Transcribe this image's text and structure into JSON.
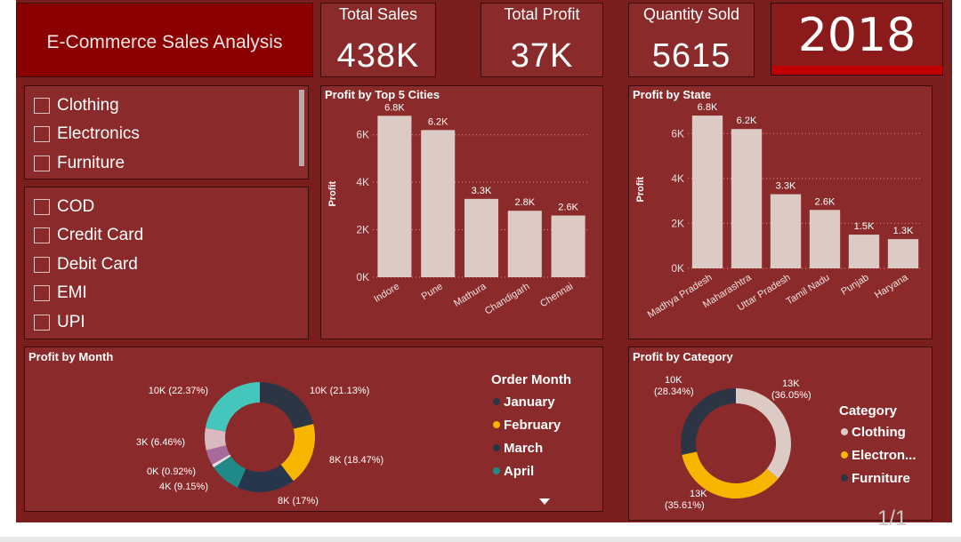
{
  "dashboard": {
    "title": "E-Commerce Sales Analysis",
    "year": "2018",
    "pager": "1/1"
  },
  "cards": {
    "total_sales": {
      "label": "Total Sales",
      "value": "438K"
    },
    "total_profit": {
      "label": "Total Profit",
      "value": "37K"
    },
    "quantity_sold": {
      "label": "Quantity Sold",
      "value": "5615"
    }
  },
  "slicers": {
    "category": [
      "Clothing",
      "Electronics",
      "Furniture"
    ],
    "payment": [
      "COD",
      "Credit Card",
      "Debit Card",
      "EMI",
      "UPI"
    ]
  },
  "colors": {
    "bar": "#dccac5",
    "dark": "#2b3544",
    "yellow": "#f7b500",
    "pink": "#d9b9bf",
    "teal": "#45c6bd",
    "purple": "#a86a9b",
    "teal_dark": "#1f8a87",
    "navy": "#27354d"
  },
  "chart_data": [
    {
      "id": "cities",
      "type": "bar",
      "title": "Profit by Top 5 Cities",
      "ylabel": "Profit",
      "categories": [
        "Indore",
        "Pune",
        "Mathura",
        "Chandigarh",
        "Chennai"
      ],
      "values": [
        6800,
        6200,
        3300,
        2800,
        2600
      ],
      "data_labels": [
        "6.8K",
        "6.2K",
        "3.3K",
        "2.8K",
        "2.6K"
      ],
      "yticks": [
        0,
        2000,
        4000,
        6000
      ],
      "ytick_labels": [
        "0K",
        "2K",
        "4K",
        "6K"
      ],
      "ylim": [
        0,
        7000
      ]
    },
    {
      "id": "states",
      "type": "bar",
      "title": "Profit by State",
      "ylabel": "Profit",
      "categories": [
        "Madhya Pradesh",
        "Maharashtra",
        "Uttar Pradesh",
        "Tamil Nadu",
        "Punjab",
        "Haryana"
      ],
      "values": [
        6800,
        6200,
        3300,
        2600,
        1500,
        1300
      ],
      "data_labels": [
        "6.8K",
        "6.2K",
        "3.3K",
        "2.6K",
        "1.5K",
        "1.3K"
      ],
      "yticks": [
        0,
        2000,
        4000,
        6000
      ],
      "ytick_labels": [
        "0K",
        "2K",
        "4K",
        "6K"
      ],
      "ylim": [
        0,
        7000
      ]
    },
    {
      "id": "months",
      "type": "pie",
      "title": "Profit by Month",
      "legend_title": "Order Month",
      "legend_visible": [
        "January",
        "February",
        "March",
        "April"
      ],
      "slices": [
        {
          "value": 21.13,
          "label": "10K (21.13%)",
          "color": "#2b3544"
        },
        {
          "value": 18.47,
          "label": "8K (18.47%)",
          "color": "#f7b500"
        },
        {
          "value": 17.0,
          "label": "8K (17%)",
          "color": "#27354d"
        },
        {
          "value": 9.15,
          "label": "4K (9.15%)",
          "color": "#1f8a87"
        },
        {
          "value": 0.92,
          "label": "0K (0.92%)",
          "color": "#e8e0e0"
        },
        {
          "value": 4.5,
          "label": "",
          "color": "#a86a9b"
        },
        {
          "value": 6.46,
          "label": "3K (6.46%)",
          "color": "#d9b9bf"
        },
        {
          "value": 22.37,
          "label": "10K (22.37%)",
          "color": "#45c6bd"
        }
      ]
    },
    {
      "id": "category",
      "type": "pie",
      "title": "Profit by Category",
      "legend_title": "Category",
      "legend": [
        "Clothing",
        "Electron...",
        "Furniture"
      ],
      "slices": [
        {
          "value": 36.05,
          "label_value": "13K",
          "label_pct": "(36.05%)",
          "color": "#dccac5"
        },
        {
          "value": 35.61,
          "label_value": "13K",
          "label_pct": "(35.61%)",
          "color": "#f7b500"
        },
        {
          "value": 28.34,
          "label_value": "10K",
          "label_pct": "(28.34%)",
          "color": "#2b3544"
        }
      ]
    }
  ]
}
